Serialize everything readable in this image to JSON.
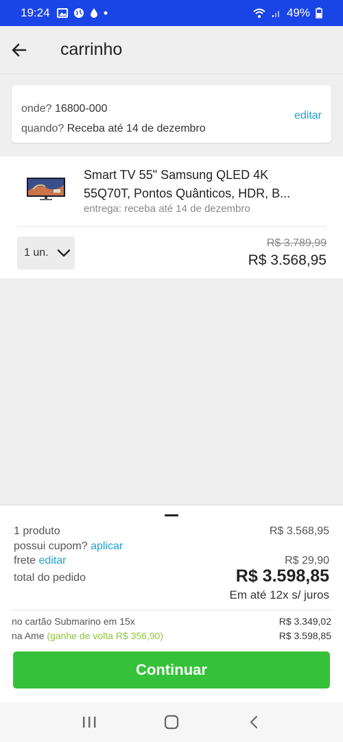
{
  "status_bar": {
    "time": "19:24",
    "battery": "49%",
    "icons": [
      "image-icon",
      "globe-icon",
      "drop-icon",
      "dot-icon",
      "wifi-icon",
      "signal-icon",
      "battery-icon"
    ]
  },
  "app_bar": {
    "title": "carrinho",
    "back_icon": "arrow-left-icon"
  },
  "address": {
    "where_label": "onde?",
    "where_value": "16800-000",
    "when_label": "quando?",
    "when_value": "Receba até 14 de dezembro",
    "edit_label": "editar"
  },
  "product": {
    "name": "Smart TV 55\" Samsung QLED 4K 55Q70T, Pontos Quânticos, HDR, B...",
    "delivery": "entrega: receba até 14 de dezembro",
    "quantity": "1 un.",
    "old_price": "R$ 3.789,99",
    "price": "R$ 3.568,95"
  },
  "summary": {
    "products_label": "1 produto",
    "products_value": "R$ 3.568,95",
    "coupon_label": "possui cupom?",
    "coupon_link": "aplicar",
    "shipping_label": "frete",
    "shipping_link": "editar",
    "shipping_value": "R$ 29,90",
    "total_label": "total do pedido",
    "total_value": "R$ 3.598,85",
    "installments": "Em até 12x s/ juros",
    "card_label": "no cartão Submarino em 15x",
    "card_value": "R$ 3.349,02",
    "ame_label": "na Ame",
    "ame_cashback": "(ganhe de volta R$ 356,90)",
    "ame_value": "R$ 3.598,85",
    "continue_label": "Continuar"
  },
  "colors": {
    "status_bar": "#1a45e6",
    "link": "#1da1d6",
    "cashback": "#8dc63f",
    "continue_button": "#35c23a"
  }
}
